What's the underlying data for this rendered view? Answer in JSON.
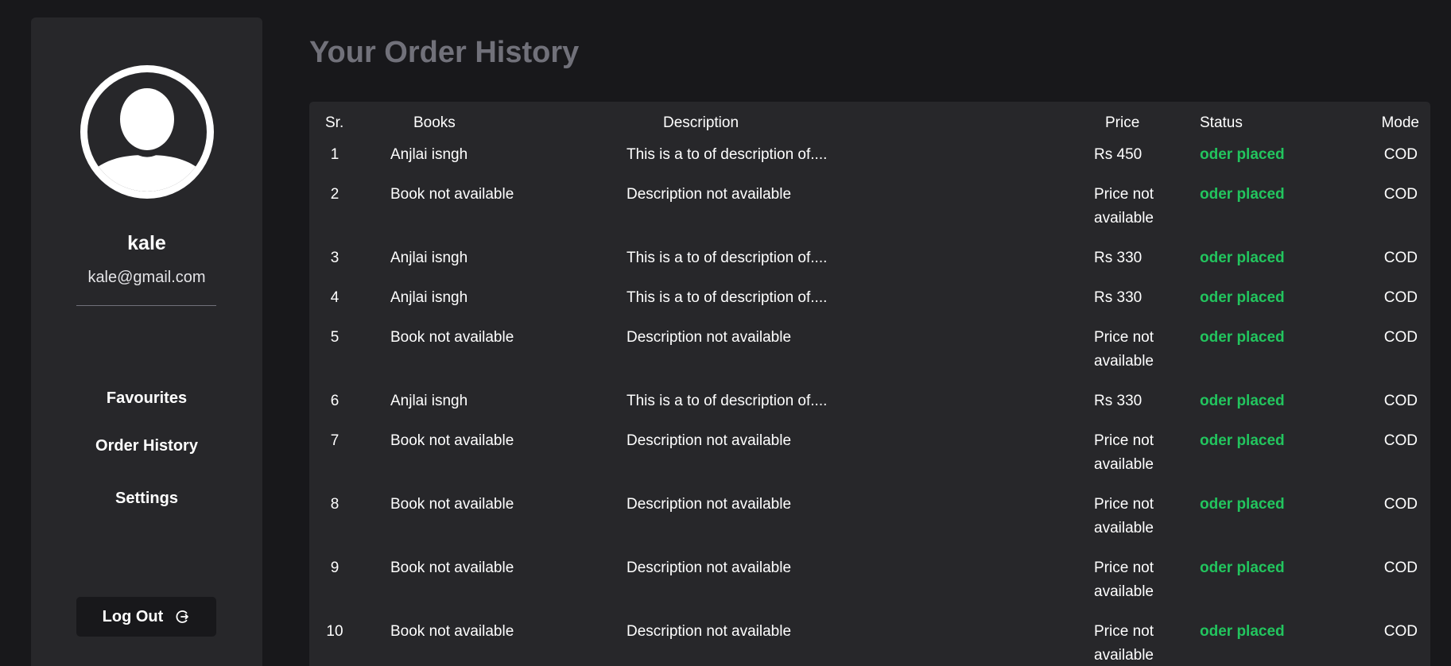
{
  "sidebar": {
    "username": "kale",
    "email": "kale@gmail.com",
    "nav": [
      {
        "label": "Favourites"
      },
      {
        "label": "Order History"
      },
      {
        "label": "Settings"
      }
    ],
    "logout_label": "Log Out"
  },
  "main": {
    "title": "Your Order History",
    "columns": {
      "sr": "Sr.",
      "books": "Books",
      "description": "Description",
      "price": "Price",
      "status": "Status",
      "mode": "Mode"
    },
    "rows": [
      {
        "sr": "1",
        "book": "Anjlai isngh",
        "description": "This is a to of description of....",
        "price": "Rs 450",
        "status": "oder placed",
        "mode": "COD"
      },
      {
        "sr": "2",
        "book": "Book not available",
        "description": "Description not available",
        "price": "Price not available",
        "status": "oder placed",
        "mode": "COD"
      },
      {
        "sr": "3",
        "book": "Anjlai isngh",
        "description": "This is a to of description of....",
        "price": "Rs 330",
        "status": "oder placed",
        "mode": "COD"
      },
      {
        "sr": "4",
        "book": "Anjlai isngh",
        "description": "This is a to of description of....",
        "price": "Rs 330",
        "status": "oder placed",
        "mode": "COD"
      },
      {
        "sr": "5",
        "book": "Book not available",
        "description": "Description not available",
        "price": "Price not available",
        "status": "oder placed",
        "mode": "COD"
      },
      {
        "sr": "6",
        "book": "Anjlai isngh",
        "description": "This is a to of description of....",
        "price": "Rs 330",
        "status": "oder placed",
        "mode": "COD"
      },
      {
        "sr": "7",
        "book": "Book not available",
        "description": "Description not available",
        "price": "Price not available",
        "status": "oder placed",
        "mode": "COD"
      },
      {
        "sr": "8",
        "book": "Book not available",
        "description": "Description not available",
        "price": "Price not available",
        "status": "oder placed",
        "mode": "COD"
      },
      {
        "sr": "9",
        "book": "Book not available",
        "description": "Description not available",
        "price": "Price not available",
        "status": "oder placed",
        "mode": "COD"
      },
      {
        "sr": "10",
        "book": "Book not available",
        "description": "Description not available",
        "price": "Price not available",
        "status": "oder placed",
        "mode": "COD"
      }
    ]
  },
  "colors": {
    "background": "#18181b",
    "panel": "#27272a",
    "status_green": "#22c55e",
    "title_gray": "#71717a"
  },
  "icons": {
    "avatar": "user-avatar-icon",
    "logout": "logout-icon"
  }
}
